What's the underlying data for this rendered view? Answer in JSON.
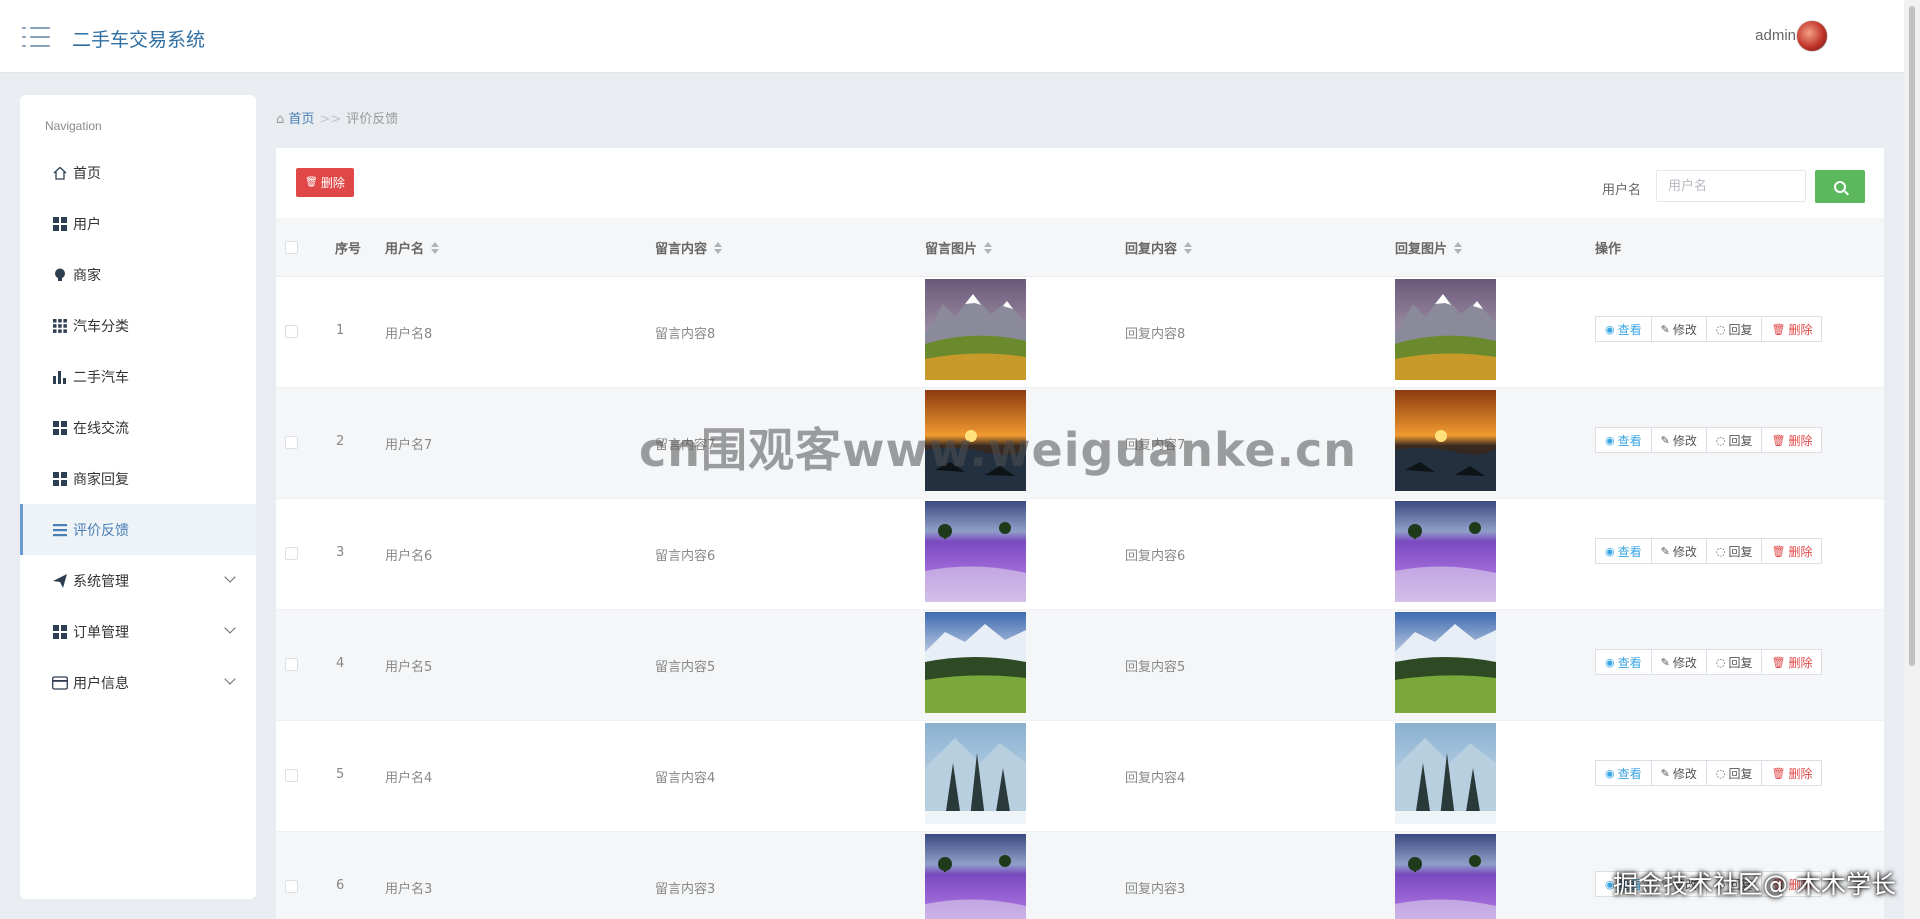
{
  "header": {
    "title": "二手车交易系统",
    "user": "admin"
  },
  "sidebar": {
    "caption": "Navigation",
    "items": [
      {
        "label": "首页",
        "icon": "home-icon",
        "expandable": false,
        "active": false
      },
      {
        "label": "用户",
        "icon": "grid-icon",
        "expandable": false,
        "active": false
      },
      {
        "label": "商家",
        "icon": "bulb-icon",
        "expandable": false,
        "active": false
      },
      {
        "label": "汽车分类",
        "icon": "apps-icon",
        "expandable": false,
        "active": false
      },
      {
        "label": "二手汽车",
        "icon": "bar-chart-icon",
        "expandable": false,
        "active": false
      },
      {
        "label": "在线交流",
        "icon": "grid-icon",
        "expandable": false,
        "active": false
      },
      {
        "label": "商家回复",
        "icon": "grid-icon",
        "expandable": false,
        "active": false
      },
      {
        "label": "评价反馈",
        "icon": "list-icon",
        "expandable": false,
        "active": true
      },
      {
        "label": "系统管理",
        "icon": "send-icon",
        "expandable": true,
        "active": false
      },
      {
        "label": "订单管理",
        "icon": "grid-icon",
        "expandable": true,
        "active": false
      },
      {
        "label": "用户信息",
        "icon": "card-icon",
        "expandable": true,
        "active": false
      }
    ]
  },
  "breadcrumb": {
    "home": "首页",
    "separator": ">>",
    "current": "评价反馈"
  },
  "toolbar": {
    "delete_label": "删除",
    "search_label": "用户名",
    "search_placeholder": "用户名"
  },
  "table": {
    "headers": {
      "index": "序号",
      "username": "用户名",
      "content": "留言内容",
      "image": "留言图片",
      "reply": "回复内容",
      "reply_image": "回复图片",
      "actions": "操作"
    },
    "actions": {
      "view": "查看",
      "edit": "修改",
      "reply": "回复",
      "delete": "删除"
    },
    "rows": [
      {
        "index": "1",
        "username": "用户名8",
        "content": "留言内容8",
        "reply": "回复内容8",
        "image": "mountain-valley"
      },
      {
        "index": "2",
        "username": "用户名7",
        "content": "留言内容7",
        "reply": "回复内容7",
        "image": "sunset-sea"
      },
      {
        "index": "3",
        "username": "用户名6",
        "content": "留言内容6",
        "reply": "回复内容6",
        "image": "lavender-field"
      },
      {
        "index": "4",
        "username": "用户名5",
        "content": "留言内容5",
        "reply": "回复内容5",
        "image": "alpine-meadow"
      },
      {
        "index": "5",
        "username": "用户名4",
        "content": "留言内容4",
        "reply": "回复内容4",
        "image": "snowy-forest"
      },
      {
        "index": "6",
        "username": "用户名3",
        "content": "留言内容3",
        "reply": "回复内容3",
        "image": "lavender-field"
      }
    ]
  },
  "watermarks": {
    "center": "cn围观客www.weiguanke.cn",
    "corner": "掘金技术社区@ 木木学长"
  }
}
